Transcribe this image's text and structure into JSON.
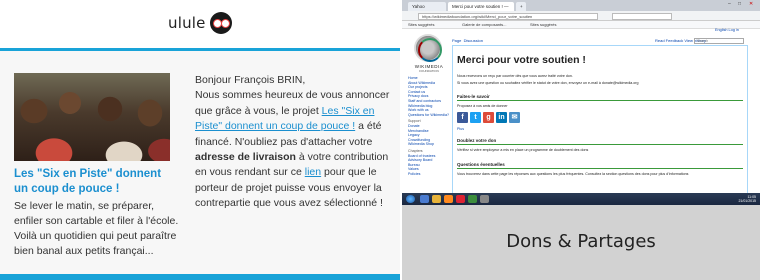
{
  "email": {
    "brand": "ulule",
    "project_title": "Les \"Six en Piste\" donnent un coup de pouce !",
    "project_desc": "Se lever le matin, se préparer, enfiler son cartable et filer à l'école. Voilà un quotidien qui peut paraître bien banal aux petits françai...",
    "greeting": "Bonjour François BRIN,",
    "body_1": "Nous sommes heureux de vous annoncer que grâce à vous, le projet",
    "project_link": "Les \"Six en Piste\" donnent un coup de pouce !",
    "body_2": "a été financé. N'oubliez pas d'attacher votre",
    "body_bold": "adresse de livraison",
    "body_3": "à votre contribution en vous rendant sur ce",
    "here_link": "lien",
    "body_4": "pour que le porteur de projet puisse vous envoyer la contrepartie que vous avez sélectionné !"
  },
  "browser": {
    "tabs": [
      "Yahoo",
      "Merci pour votre soutien ! —",
      ""
    ],
    "url": "https://wikimediafoundation.org/wiki/Merci_pour_votre_soutien",
    "bookmarks": [
      "Sites suggérés",
      "Galerie de composants...",
      "Sites suggérés"
    ],
    "org_name": "WIKIMEDIA",
    "org_sub": "FOUNDATION",
    "nav": [
      "Home",
      "About Wikimedia",
      "Our projects",
      "Contact us",
      "Privacy docs",
      "Staff and contractors",
      "Wikimedia blog",
      "Work with us",
      "Questions for Wikimedia?"
    ],
    "nav_groups": [
      {
        "heading": "Support",
        "items": [
          "Donate",
          "Merchandise",
          "Legacy",
          "Crowdfunding",
          "Wikimedia Shop"
        ]
      },
      {
        "heading": "Chapters",
        "items": [
          "Board of trustees",
          "Advisory Board",
          "Bureau",
          "Values",
          "Policies"
        ]
      }
    ],
    "page_tab": "Page",
    "page_tab2": "Discussion",
    "view_tabs": "Read   Feedback   View history",
    "login": "English   Log in",
    "search_placeholder": "Search",
    "heading": "Merci pour votre soutien !",
    "para_1": "Nous recevrons un reçu par courrier dès que vous aurez traité votre don.",
    "para_2": "Si vous avez une question ou souhaitez vérifier le statut de votre don, envoyez un e-mail à donate@wikimedia.org",
    "sec_1": "Faites-le savoir",
    "sec_1_text": "Proposez à vos amis de donner",
    "plus": "Plus",
    "sec_2": "Doublez votre don",
    "sec_2_text": "Vérifiez si votre employeur a mis en place un programme de doublement des dons",
    "sec_3": "Questions éventuelles",
    "sec_3_text": "Vous trouverez dans cette page les réponses aux questions les plus fréquentes. Consultez la section questions des dons pour plus d'informations",
    "clock_time": "11:05",
    "clock_date": "21/01/2015",
    "social_icons": [
      "facebook-icon",
      "twitter-icon",
      "google-plus-icon",
      "linkedin-icon",
      "email-icon"
    ]
  },
  "caption": "Dons & Partages"
}
